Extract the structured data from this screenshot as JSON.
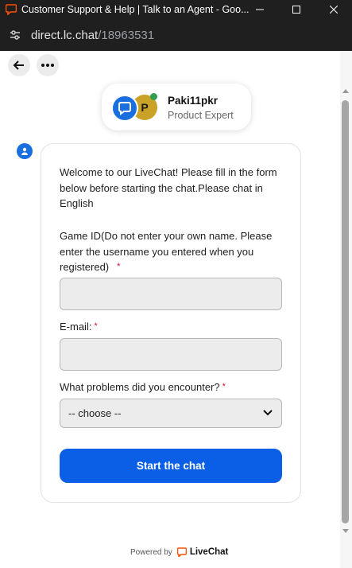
{
  "window": {
    "title": "Customer Support & Help | Talk to an Agent - Goo...",
    "url_host": "direct.lc.chat",
    "url_path": "/18963531"
  },
  "agent": {
    "name": "Paki11pkr",
    "role": "Product Expert",
    "avatar_initial": "P",
    "status_color": "#2e9e4f"
  },
  "form": {
    "intro": "Welcome to our LiveChat! Please fill in the form below before starting the chat.Please chat in English",
    "game_id_label": "Game ID(Do not enter your own name. Please enter the username you entered when you registered)",
    "game_id_value": "",
    "email_label": "E-mail:",
    "email_value": "",
    "problem_label": "What problems did you encounter?",
    "problem_selected": "-- choose --",
    "required_mark": "*",
    "submit_label": "Start the chat"
  },
  "footer": {
    "powered_by": "Powered by",
    "brand": "LiveChat"
  },
  "colors": {
    "accent": "#0b5fe6",
    "livechat_orange": "#ff5100",
    "required": "#d0102e"
  },
  "icons": {
    "back": "arrow-left-icon",
    "more": "more-horizontal-icon",
    "site_info": "tune-icon",
    "chevron": "chevron-down-icon"
  }
}
